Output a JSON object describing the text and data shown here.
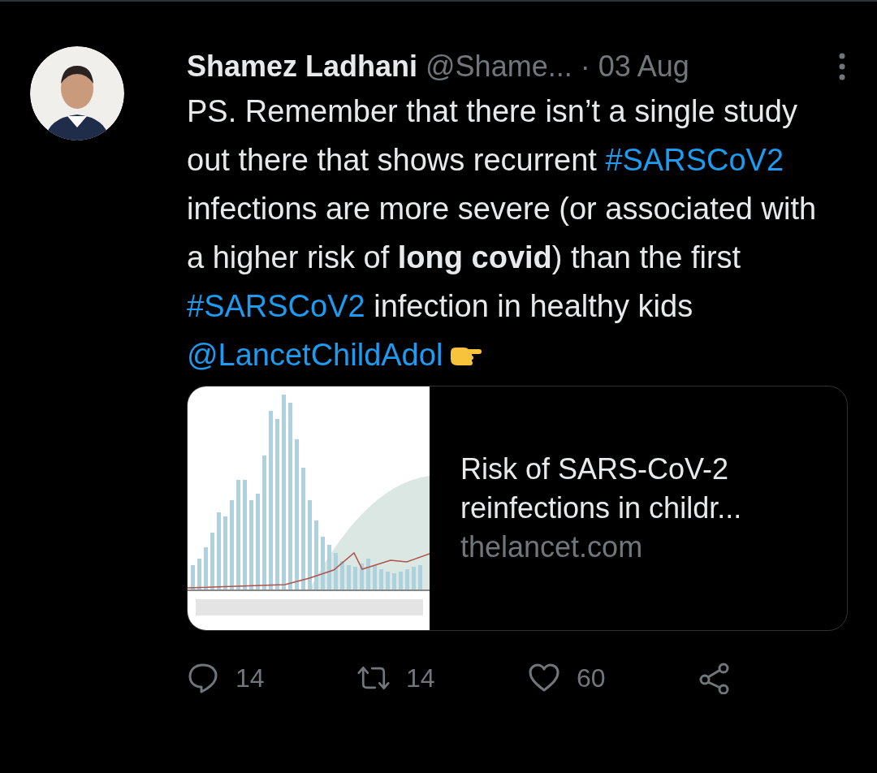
{
  "tweet": {
    "author": {
      "name": "Shamez Ladhani",
      "handle": "@Shame...",
      "time": "· 03 Aug"
    },
    "body": [
      {
        "kind": "text",
        "text": "PS. Remember that there isn’t a single study out there that shows recurrent "
      },
      {
        "kind": "hashtag",
        "text": "#SARSCoV2"
      },
      {
        "kind": "text",
        "text": " infections are more severe (or associated with a higher risk of **long covid**) than the first "
      },
      {
        "kind": "hashtag",
        "text": "#SARSCoV2"
      },
      {
        "kind": "text",
        "text": " infection in healthy kids "
      },
      {
        "kind": "mention",
        "text": "@LancetChildAdol"
      },
      {
        "kind": "emoji"
      }
    ],
    "card": {
      "title": "Risk of SARS-CoV-2 reinfections in childr...",
      "domain": "thelancet.com"
    },
    "actions": [
      {
        "kind": "reply",
        "count": "14"
      },
      {
        "kind": "retweet",
        "count": "14"
      },
      {
        "kind": "like",
        "count": "60"
      },
      {
        "kind": "share"
      }
    ]
  }
}
